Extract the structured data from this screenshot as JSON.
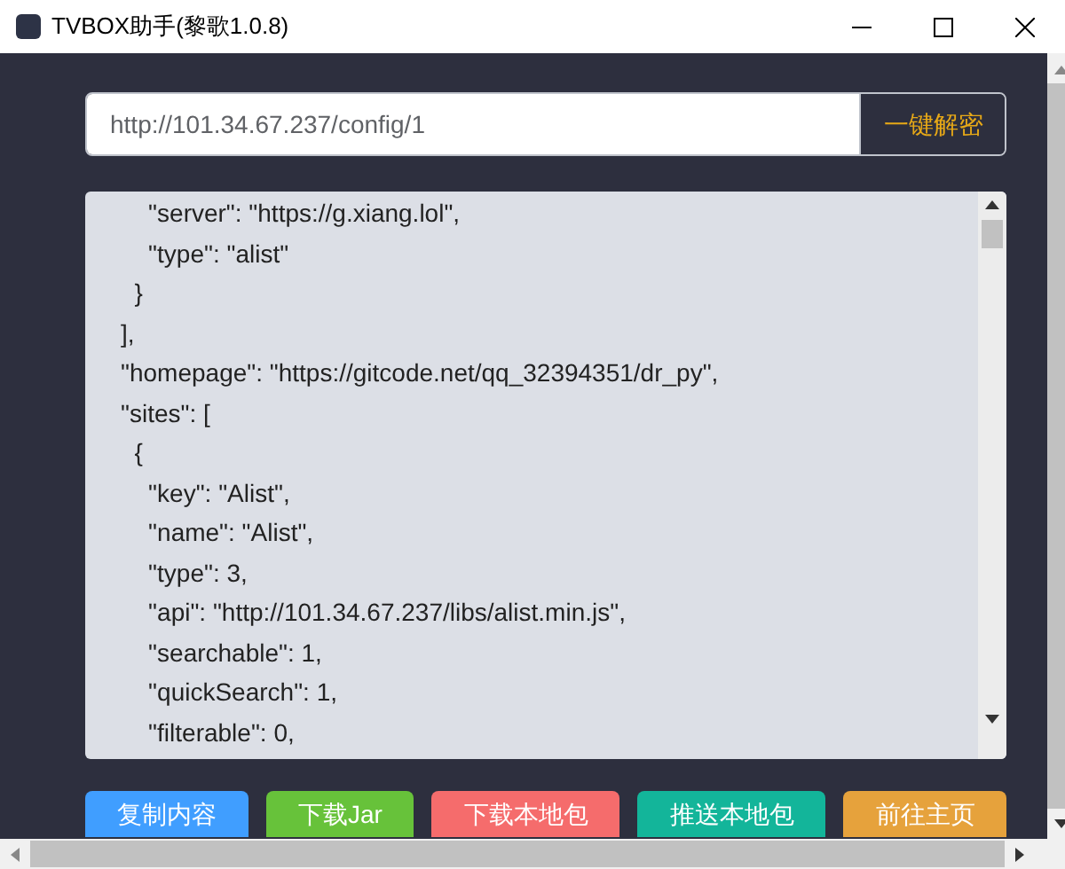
{
  "window": {
    "title": "TVBOX助手(黎歌1.0.8)"
  },
  "url_field": {
    "value": "http://101.34.67.237/config/1"
  },
  "decrypt_button": {
    "label": "一键解密"
  },
  "content_lines": [
    "    \"server\": \"https://g.xiang.lol\",",
    "    \"type\": \"alist\"",
    "  }",
    "],",
    "\"homepage\": \"https://gitcode.net/qq_32394351/dr_py\",",
    "\"sites\": [",
    "  {",
    "    \"key\": \"Alist\",",
    "    \"name\": \"Alist\",",
    "    \"type\": 3,",
    "    \"api\": \"http://101.34.67.237/libs/alist.min.js\",",
    "    \"searchable\": 1,",
    "    \"quickSearch\": 1,",
    "    \"filterable\": 0,"
  ],
  "buttons": [
    {
      "label": "复制内容",
      "color": "#409eff"
    },
    {
      "label": "下载Jar",
      "color": "#67c23a"
    },
    {
      "label": "下载本地包",
      "color": "#f56c6c"
    },
    {
      "label": "推送本地包",
      "color": "#13b59a"
    },
    {
      "label": "前往主页",
      "color": "#e6a23c"
    }
  ]
}
